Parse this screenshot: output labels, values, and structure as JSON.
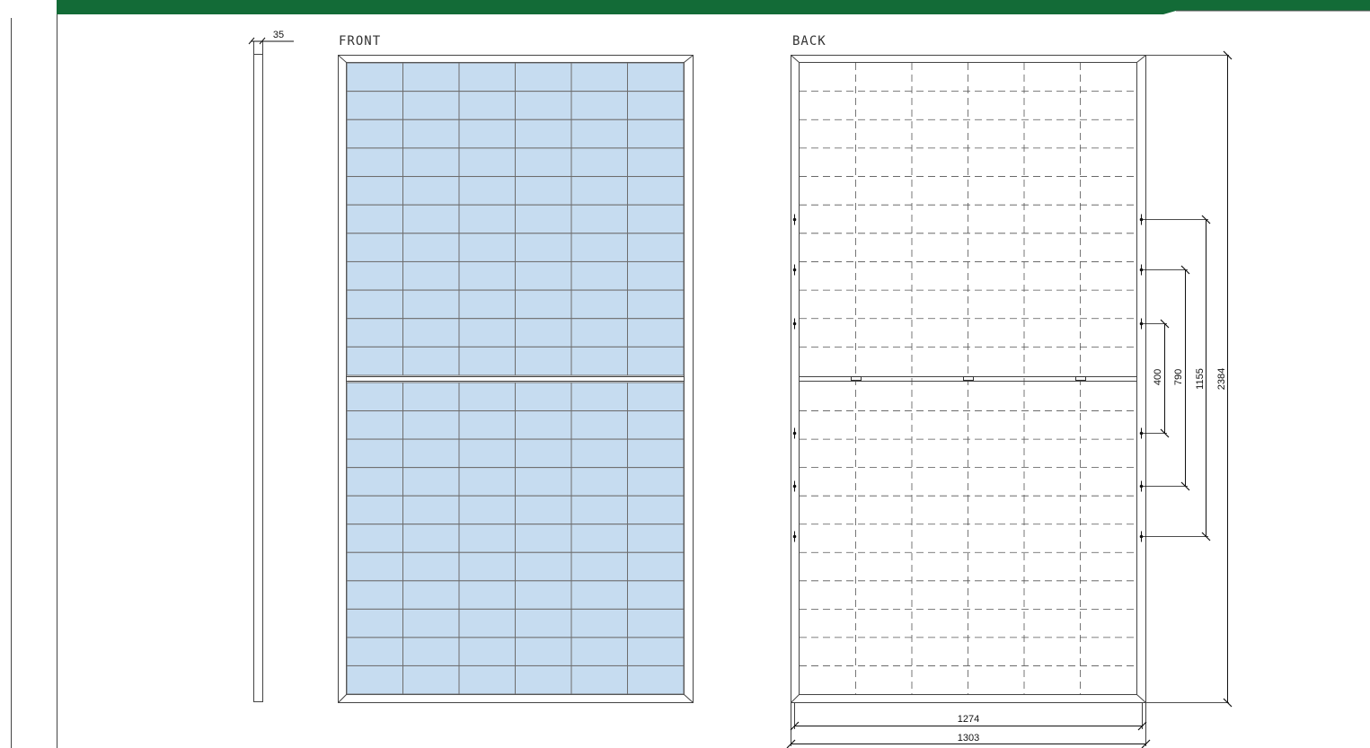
{
  "colors": {
    "header_band": "#136b37",
    "cell_fill": "#c6dcf0",
    "cell_line": "#6d6d6d",
    "frame": "#444444",
    "dashed_grid": "#555555"
  },
  "labels": {
    "front": "FRONT",
    "back": "BACK"
  },
  "panel": {
    "cell_columns": 6,
    "cell_rows_per_half": 11
  },
  "dimensions": {
    "thickness": "35",
    "hole_spacing_inner": "400",
    "hole_spacing_middle": "790",
    "hole_spacing_outer": "1155",
    "total_length": "2384",
    "inner_width": "1274",
    "total_width": "1303"
  }
}
